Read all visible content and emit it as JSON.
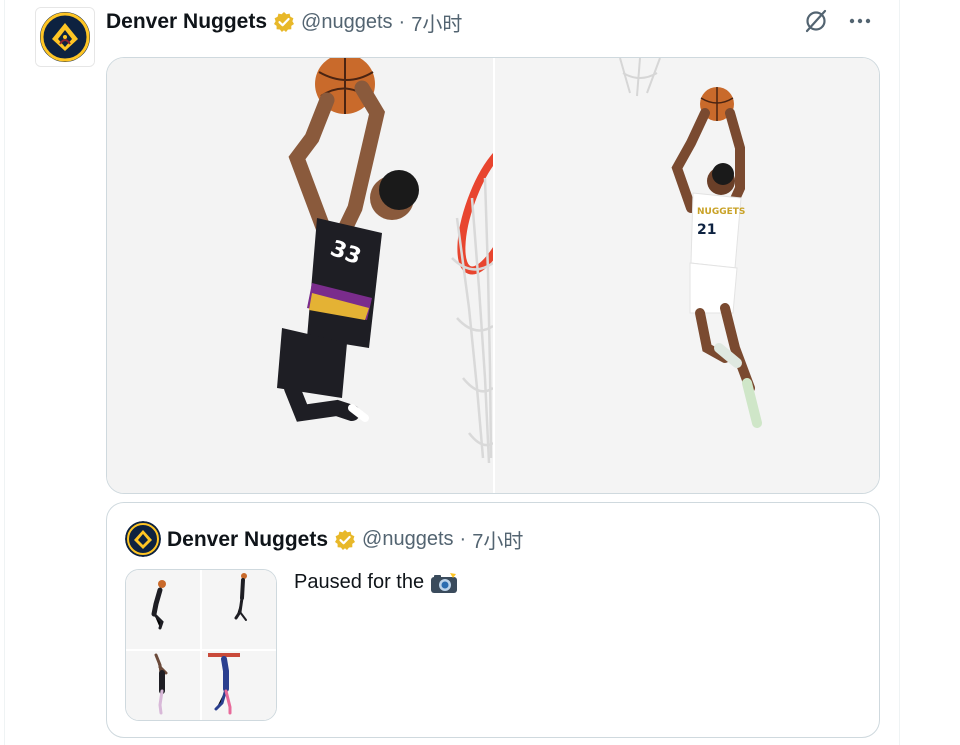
{
  "post": {
    "author_name": "Denver Nuggets",
    "handle": "@nuggets",
    "separator": "·",
    "time": "7小时",
    "verified_icon": "verified-badge-icon",
    "avatar_icon": "nuggets-logo-icon",
    "actions": [
      {
        "name": "grok-icon"
      },
      {
        "name": "more-options-icon"
      }
    ],
    "media": [
      {
        "name": "photo-dunk-black-jersey",
        "jersey_number": "33"
      },
      {
        "name": "photo-dunk-white-jersey",
        "jersey_number": "21",
        "jersey_text": "NUGGETS"
      }
    ]
  },
  "quote": {
    "author_name": "Denver Nuggets",
    "handle": "@nuggets",
    "separator": "·",
    "time": "7小时",
    "text": "Paused for the",
    "emoji_icon": "camera-flash-icon",
    "thumbnails": 4
  },
  "colors": {
    "navy": "#0d2240",
    "gold": "#fec524",
    "red": "#8b2131",
    "verified_gold": "#e8b829",
    "muted": "#536471",
    "border": "#cfd9de"
  }
}
